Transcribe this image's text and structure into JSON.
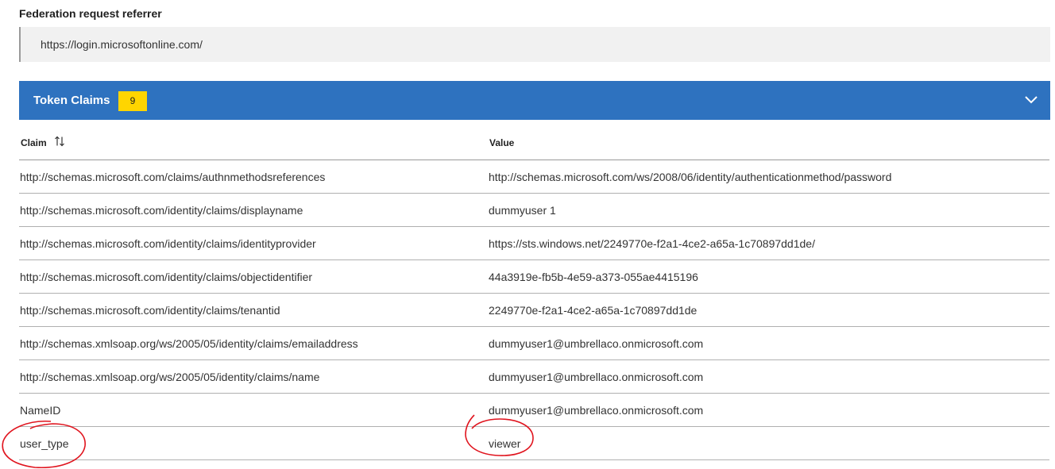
{
  "referrer": {
    "label": "Federation request referrer",
    "value": "https://login.microsoftonline.com/"
  },
  "token_claims": {
    "title": "Token Claims",
    "count": "9",
    "header_color": "#2e72bf",
    "badge_color": "#ffd500",
    "toggle_icon": "chevron-down-icon"
  },
  "table": {
    "columns": {
      "claim": "Claim",
      "value": "Value"
    },
    "sort_icon": "sort-arrows-icon",
    "rows": [
      {
        "claim": "http://schemas.microsoft.com/claims/authnmethodsreferences",
        "value": "http://schemas.microsoft.com/ws/2008/06/identity/authenticationmethod/password"
      },
      {
        "claim": "http://schemas.microsoft.com/identity/claims/displayname",
        "value": "dummyuser 1"
      },
      {
        "claim": "http://schemas.microsoft.com/identity/claims/identityprovider",
        "value": "https://sts.windows.net/2249770e-f2a1-4ce2-a65a-1c70897dd1de/"
      },
      {
        "claim": "http://schemas.microsoft.com/identity/claims/objectidentifier",
        "value": "44a3919e-fb5b-4e59-a373-055ae4415196"
      },
      {
        "claim": "http://schemas.microsoft.com/identity/claims/tenantid",
        "value": "2249770e-f2a1-4ce2-a65a-1c70897dd1de"
      },
      {
        "claim": "http://schemas.xmlsoap.org/ws/2005/05/identity/claims/emailaddress",
        "value": "dummyuser1@umbrellaco.onmicrosoft.com"
      },
      {
        "claim": "http://schemas.xmlsoap.org/ws/2005/05/identity/claims/name",
        "value": "dummyuser1@umbrellaco.onmicrosoft.com"
      },
      {
        "claim": "NameID",
        "value": "dummyuser1@umbrellaco.onmicrosoft.com"
      },
      {
        "claim": "user_type",
        "value": "viewer"
      }
    ]
  },
  "annotation_color": "#e0141e"
}
